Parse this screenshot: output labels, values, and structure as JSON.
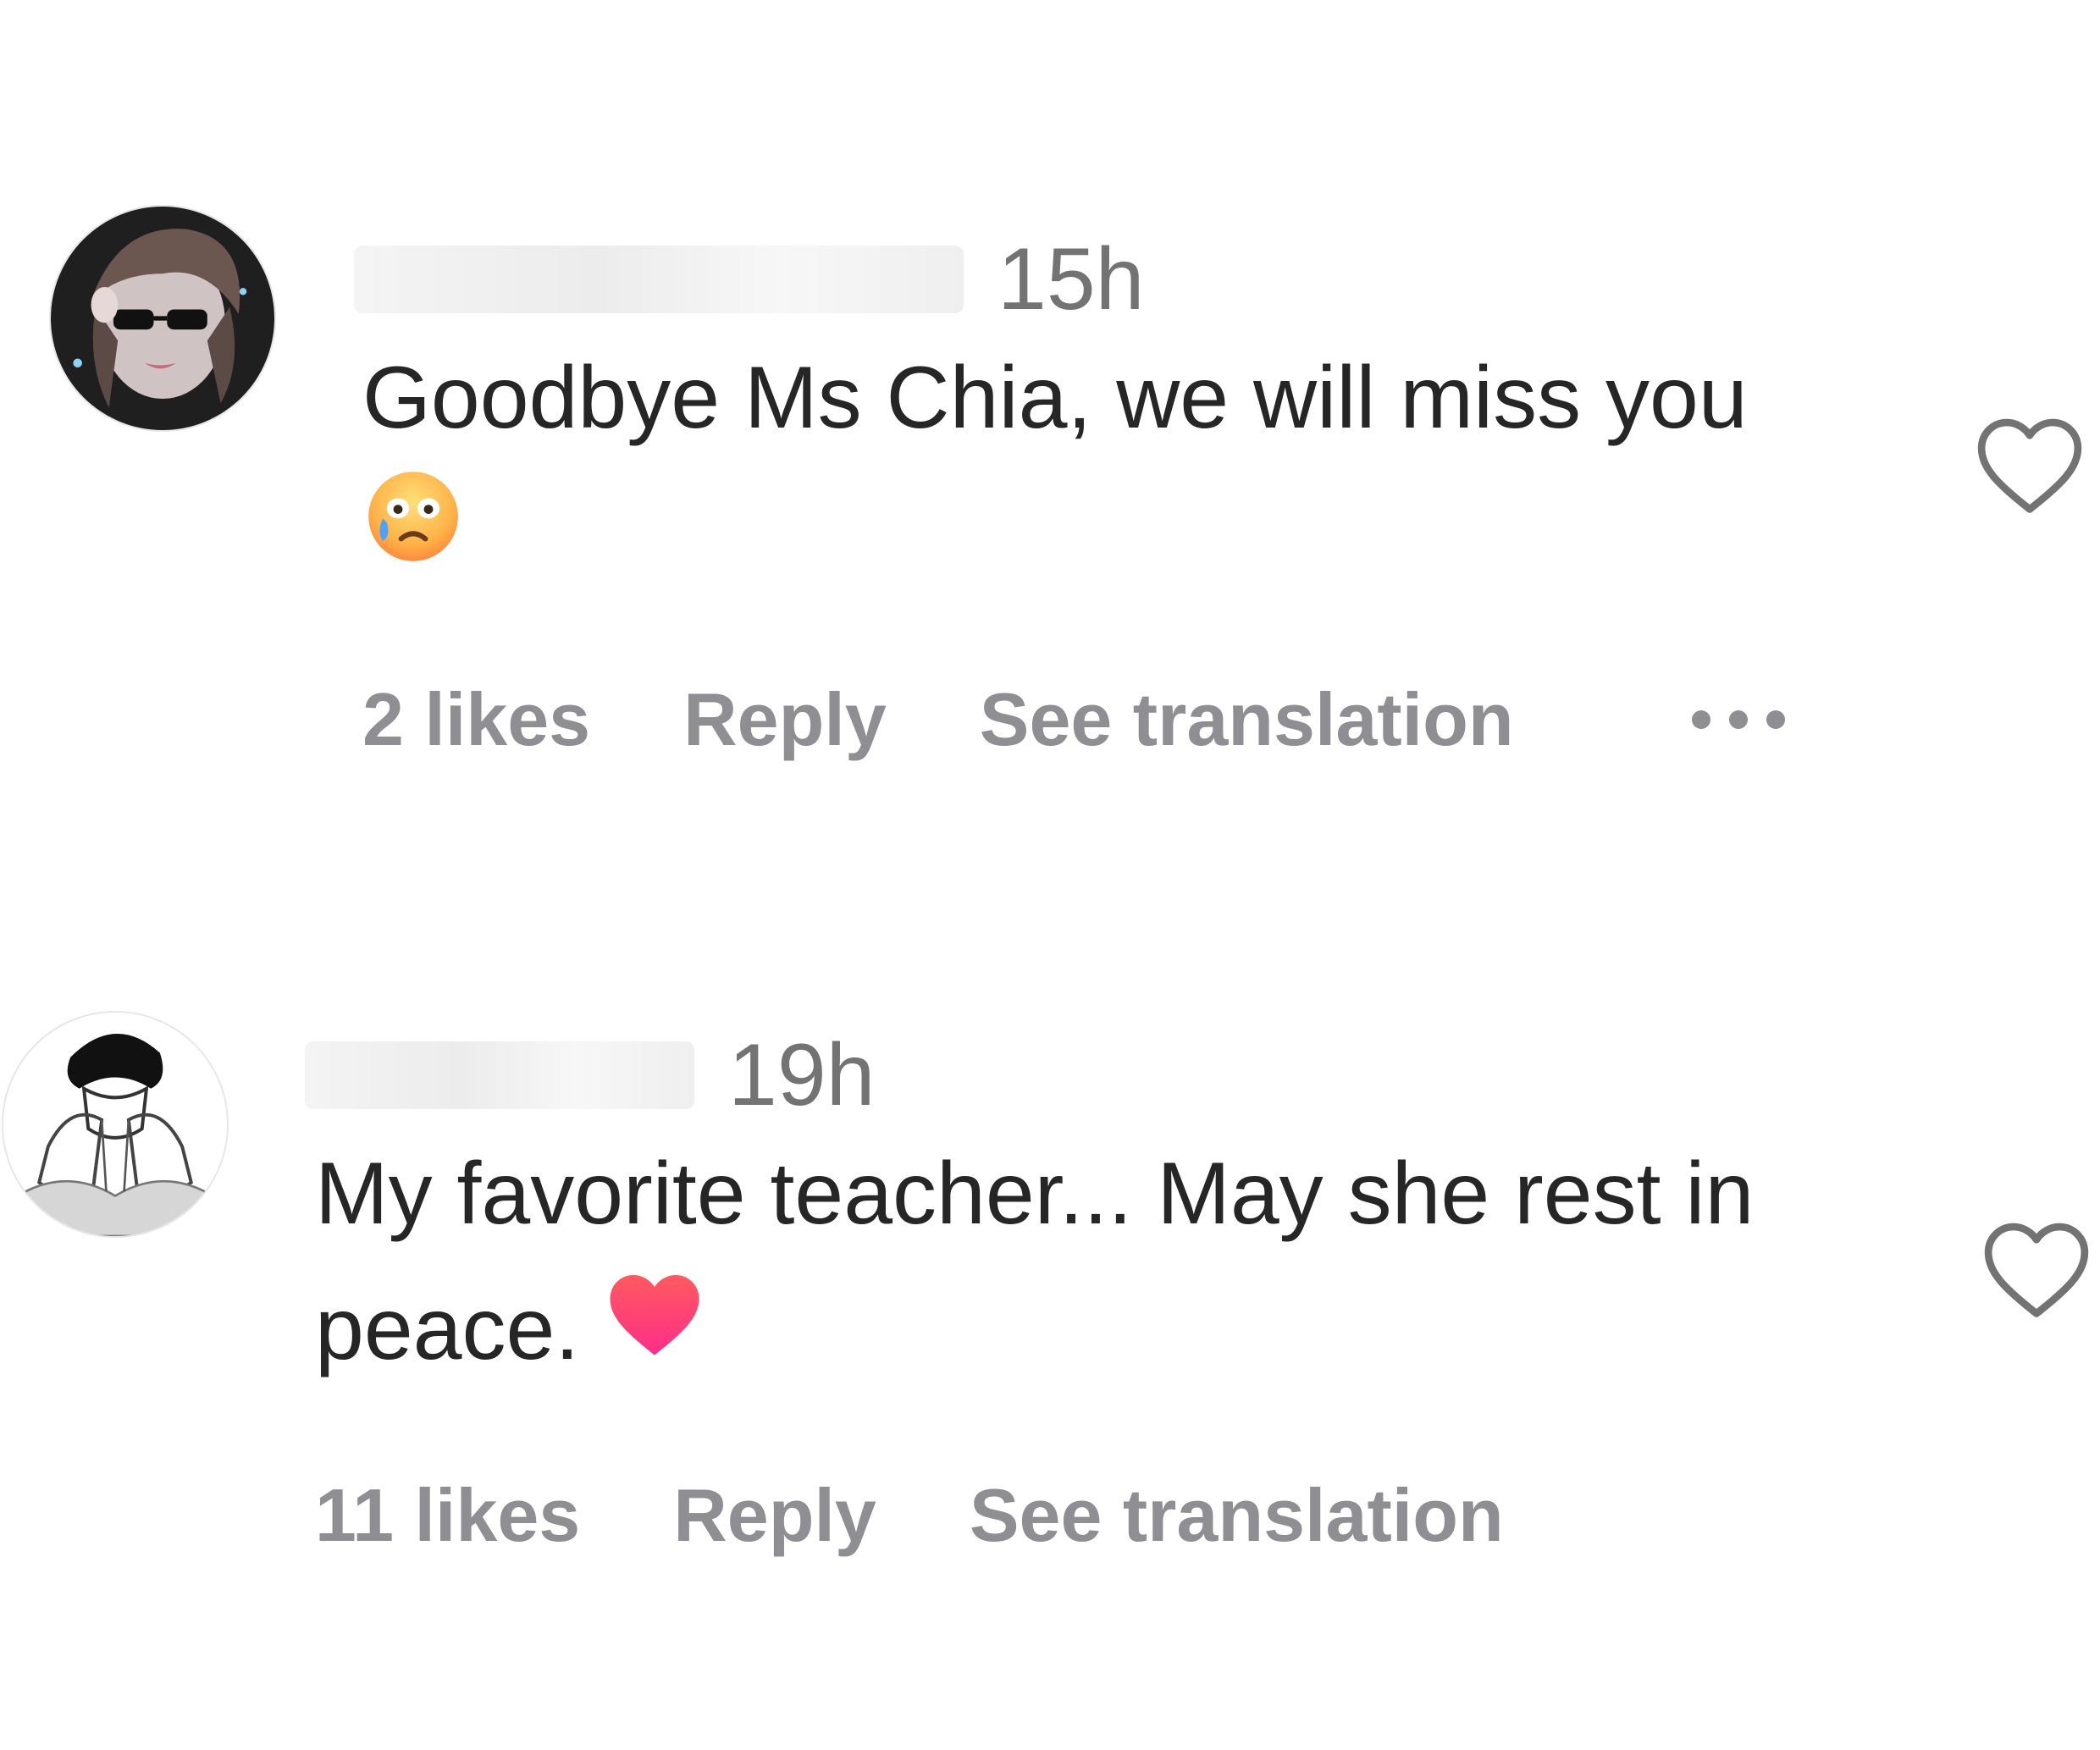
{
  "comments": [
    {
      "username": "",
      "time": "15h",
      "text": "Goodbye Ms Chia, we will miss you",
      "emoji": "crying-face",
      "likes": "2 likes",
      "reply_label": "Reply",
      "translate_label": "See translation",
      "has_more_menu": true
    },
    {
      "username": "",
      "time": "19h",
      "text": "My favorite teacher... May she rest in peace.",
      "emoji": "red-heart",
      "likes": "11 likes",
      "reply_label": "Reply",
      "translate_label": "See translation",
      "has_more_menu": false
    }
  ],
  "colors": {
    "text": "#262626",
    "secondary": "#8e8e93",
    "timestamp": "#737373",
    "heart_outline": "#737373"
  }
}
